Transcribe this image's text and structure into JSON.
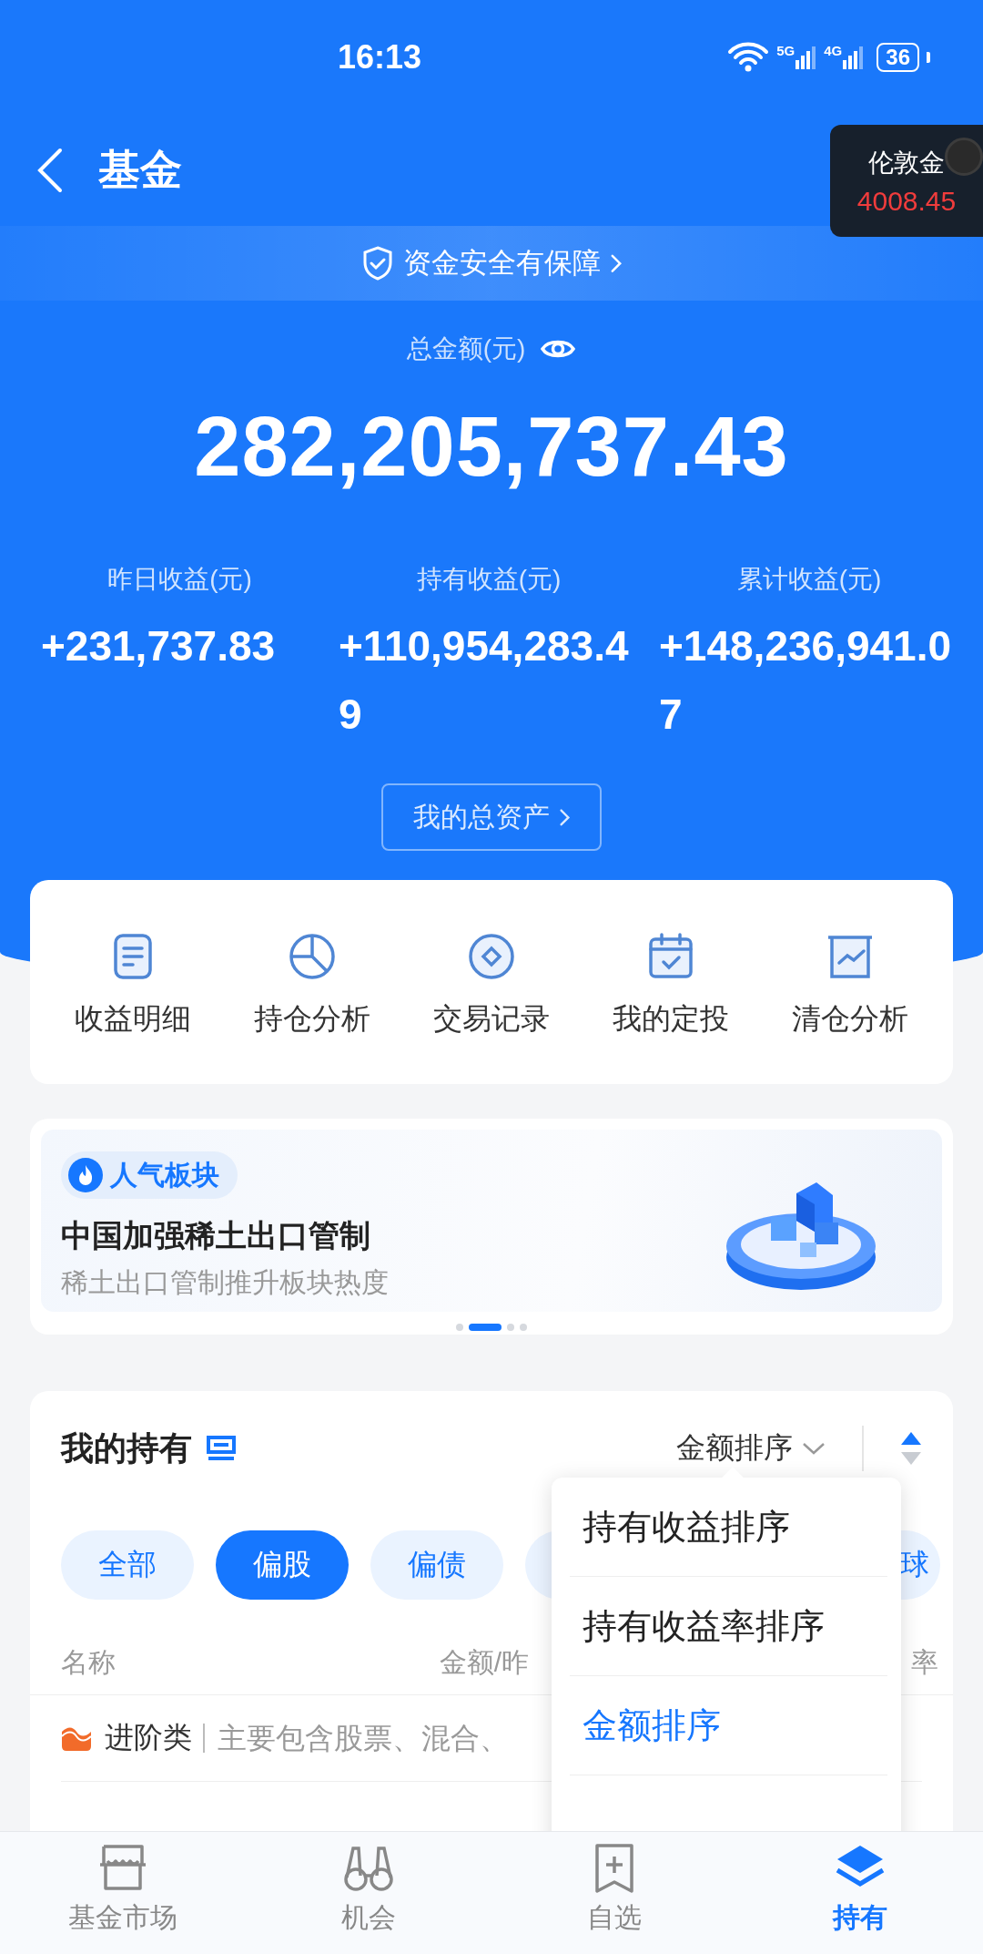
{
  "status_bar": {
    "time": "16:13",
    "network_1": "5G",
    "network_2": "4G",
    "battery": "36"
  },
  "header": {
    "title": "基金"
  },
  "ticker_widget": {
    "name": "伦敦金",
    "price": "4008.45"
  },
  "security_banner": {
    "text": "资金安全有保障"
  },
  "summary": {
    "total_label": "总金额(元)",
    "total_value": "282,205,737.43",
    "stats": [
      {
        "label": "昨日收益(元)",
        "value": "+231,737.83"
      },
      {
        "label": "持有收益(元)",
        "value": "+110,954,283.49"
      },
      {
        "label": "累计收益(元)",
        "value": "+148,236,941.07"
      }
    ],
    "assets_button": "我的总资产"
  },
  "quick_actions": [
    {
      "kind": "document",
      "label": "收益明细"
    },
    {
      "kind": "pie",
      "label": "持仓分析"
    },
    {
      "kind": "coin",
      "label": "交易记录"
    },
    {
      "kind": "calendar",
      "label": "我的定投"
    },
    {
      "kind": "chart",
      "label": "清仓分析"
    }
  ],
  "promo": {
    "tag": "人气板块",
    "title": "中国加强稀土出口管制",
    "subtitle": "稀土出口管制推升板块热度",
    "pages": [
      {
        "selected": false
      },
      {
        "selected": true
      },
      {
        "selected": false
      },
      {
        "selected": false
      }
    ]
  },
  "holdings": {
    "title": "我的持有",
    "sort_label": "金额排序",
    "filters": [
      {
        "label": "全部",
        "selected": false
      },
      {
        "label": "偏股",
        "selected": true
      },
      {
        "label": "偏债",
        "selected": false
      },
      {
        "selected": false
      },
      {
        "label": "球",
        "selected": false
      }
    ],
    "columns": [
      "名称",
      "金额/昨",
      "率"
    ],
    "categories": [
      {
        "name": "进阶类",
        "description": "主要包含股票、混合、"
      }
    ]
  },
  "sort_menu": [
    {
      "label": "持有收益排序",
      "selected": false
    },
    {
      "label": "持有收益率排序",
      "selected": false
    },
    {
      "label": "金额排序",
      "selected": true
    }
  ],
  "bottom_nav": [
    {
      "kind": "market",
      "label": "基金市场",
      "selected": false
    },
    {
      "kind": "binoculars",
      "label": "机会",
      "selected": false
    },
    {
      "kind": "bookmark",
      "label": "自选",
      "selected": false
    },
    {
      "kind": "layers",
      "label": "持有",
      "selected": true
    }
  ]
}
